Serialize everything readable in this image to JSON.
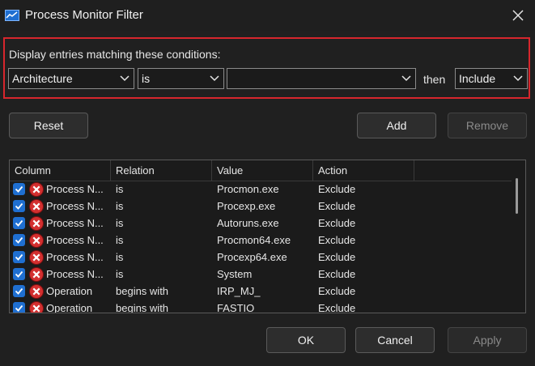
{
  "window": {
    "title": "Process Monitor Filter",
    "accent": "#1f6fd1",
    "highlight": "#d7262d"
  },
  "conditions": {
    "label": "Display entries matching these conditions:",
    "column": "Architecture",
    "relation": "is",
    "value": "",
    "then_label": "then",
    "action": "Include"
  },
  "buttons": {
    "reset": "Reset",
    "add": "Add",
    "remove": "Remove",
    "ok": "OK",
    "cancel": "Cancel",
    "apply": "Apply"
  },
  "table": {
    "headers": [
      "Column",
      "Relation",
      "Value",
      "Action"
    ],
    "rows": [
      {
        "column": "Process N...",
        "relation": "is",
        "value": "Procmon.exe",
        "action": "Exclude",
        "checked": true
      },
      {
        "column": "Process N...",
        "relation": "is",
        "value": "Procexp.exe",
        "action": "Exclude",
        "checked": true
      },
      {
        "column": "Process N...",
        "relation": "is",
        "value": "Autoruns.exe",
        "action": "Exclude",
        "checked": true
      },
      {
        "column": "Process N...",
        "relation": "is",
        "value": "Procmon64.exe",
        "action": "Exclude",
        "checked": true
      },
      {
        "column": "Process N...",
        "relation": "is",
        "value": "Procexp64.exe",
        "action": "Exclude",
        "checked": true
      },
      {
        "column": "Process N...",
        "relation": "is",
        "value": "System",
        "action": "Exclude",
        "checked": true
      },
      {
        "column": "Operation",
        "relation": "begins with",
        "value": "IRP_MJ_",
        "action": "Exclude",
        "checked": true
      },
      {
        "column": "Operation",
        "relation": "begins with",
        "value": "FASTIO_",
        "action": "Exclude",
        "checked": true
      }
    ]
  }
}
